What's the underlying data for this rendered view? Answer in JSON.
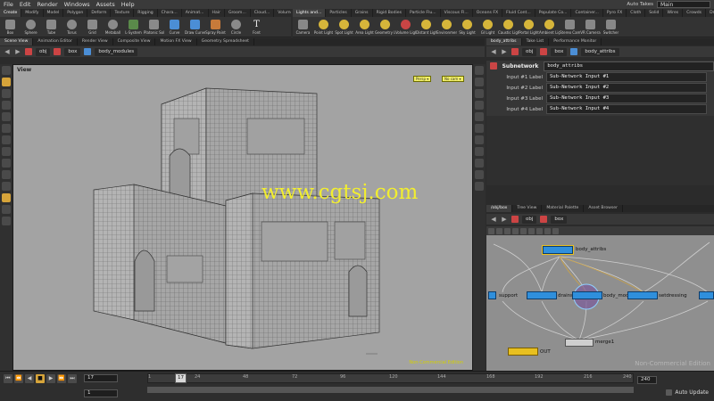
{
  "menubar": {
    "items": [
      "File",
      "Edit",
      "Render",
      "Windows",
      "Assets",
      "Help"
    ],
    "auto_takes": "Auto Takes",
    "desktop": "Main"
  },
  "shelf_left": {
    "tabs": [
      "Create",
      "Modify",
      "Model",
      "Polygon",
      "Deform",
      "Texture",
      "Rigging",
      "Chara...",
      "Animat...",
      "Hair",
      "Groom...",
      "Cloud...",
      "Volume"
    ],
    "tools": [
      "Box",
      "Sphere",
      "Tube",
      "Torus",
      "Grid",
      "Metaball",
      "L-System",
      "Platonic Sol...",
      "Curve",
      "Draw Curve",
      "Spray Paint",
      "Circle",
      "Font"
    ]
  },
  "shelf_right": {
    "tabs": [
      "Lights and...",
      "Particles",
      "Grains",
      "Rigid Bodies",
      "Particle Flu...",
      "Viscous Fl...",
      "Oceans FX",
      "Fluid Cont...",
      "Populate Co...",
      "Container...",
      "Pyro FX",
      "Cloth",
      "Solid",
      "Wires",
      "Crowds",
      "Drive Simu..."
    ],
    "tools": [
      "Camera",
      "Point Light",
      "Spot Light",
      "Area Light",
      "Geometry L...",
      "Volume Light",
      "Distant Light",
      "Environmen...",
      "Sky Light",
      "GI Light",
      "Caustic Light",
      "Portal Light",
      "Ambient Lig...",
      "Stereo Cam...",
      "VR Camera",
      "Switcher"
    ]
  },
  "left_tabs": [
    "Scene View",
    "Animation Editor",
    "Render View",
    "Composite View",
    "Motion FX View",
    "Geometry Spreadsheet"
  ],
  "left_path": {
    "root": "obj",
    "node1": "box",
    "node2": "body_modules"
  },
  "viewport": {
    "title": "View",
    "persp": "Persp ▾",
    "cam": "No cam ▾",
    "watermark": "www.cgtsj.com",
    "edition": "Non-Commercial Edition"
  },
  "param_tabs": [
    "body_attribs",
    "Take List",
    "Performance Monitor"
  ],
  "param_path": {
    "root": "obj",
    "node1": "box",
    "node2": "body_attribs"
  },
  "params": {
    "type_label": "Subnetwork",
    "node_name": "body_attribs",
    "rows": [
      {
        "label": "Input #1 Label",
        "value": "Sub-Network Input #1"
      },
      {
        "label": "Input #2 Label",
        "value": "Sub-Network Input #2"
      },
      {
        "label": "Input #3 Label",
        "value": "Sub-Network Input #3"
      },
      {
        "label": "Input #4 Label",
        "value": "Sub-Network Input #4"
      }
    ]
  },
  "net_tabs": [
    "/obj/box",
    "Tree View",
    "Material Palette",
    "Asset Browser"
  ],
  "net_path": {
    "root": "obj",
    "node1": "box"
  },
  "network": {
    "nodes": {
      "attribs": "body_attribs",
      "support": "support",
      "drains": "drains",
      "modules": "body_modules",
      "setdress": "setdressing",
      "merge": "merge1",
      "out": "OUT"
    },
    "watermark": "Non-Commercial Edition"
  },
  "timeline": {
    "ticks": [
      "1",
      "24",
      "48",
      "72",
      "96",
      "120",
      "144",
      "168",
      "192",
      "216",
      "240"
    ],
    "current_frame": "17",
    "frame_field": "17",
    "start_field": "1",
    "end_field": "240",
    "auto_update": "Auto Update"
  }
}
